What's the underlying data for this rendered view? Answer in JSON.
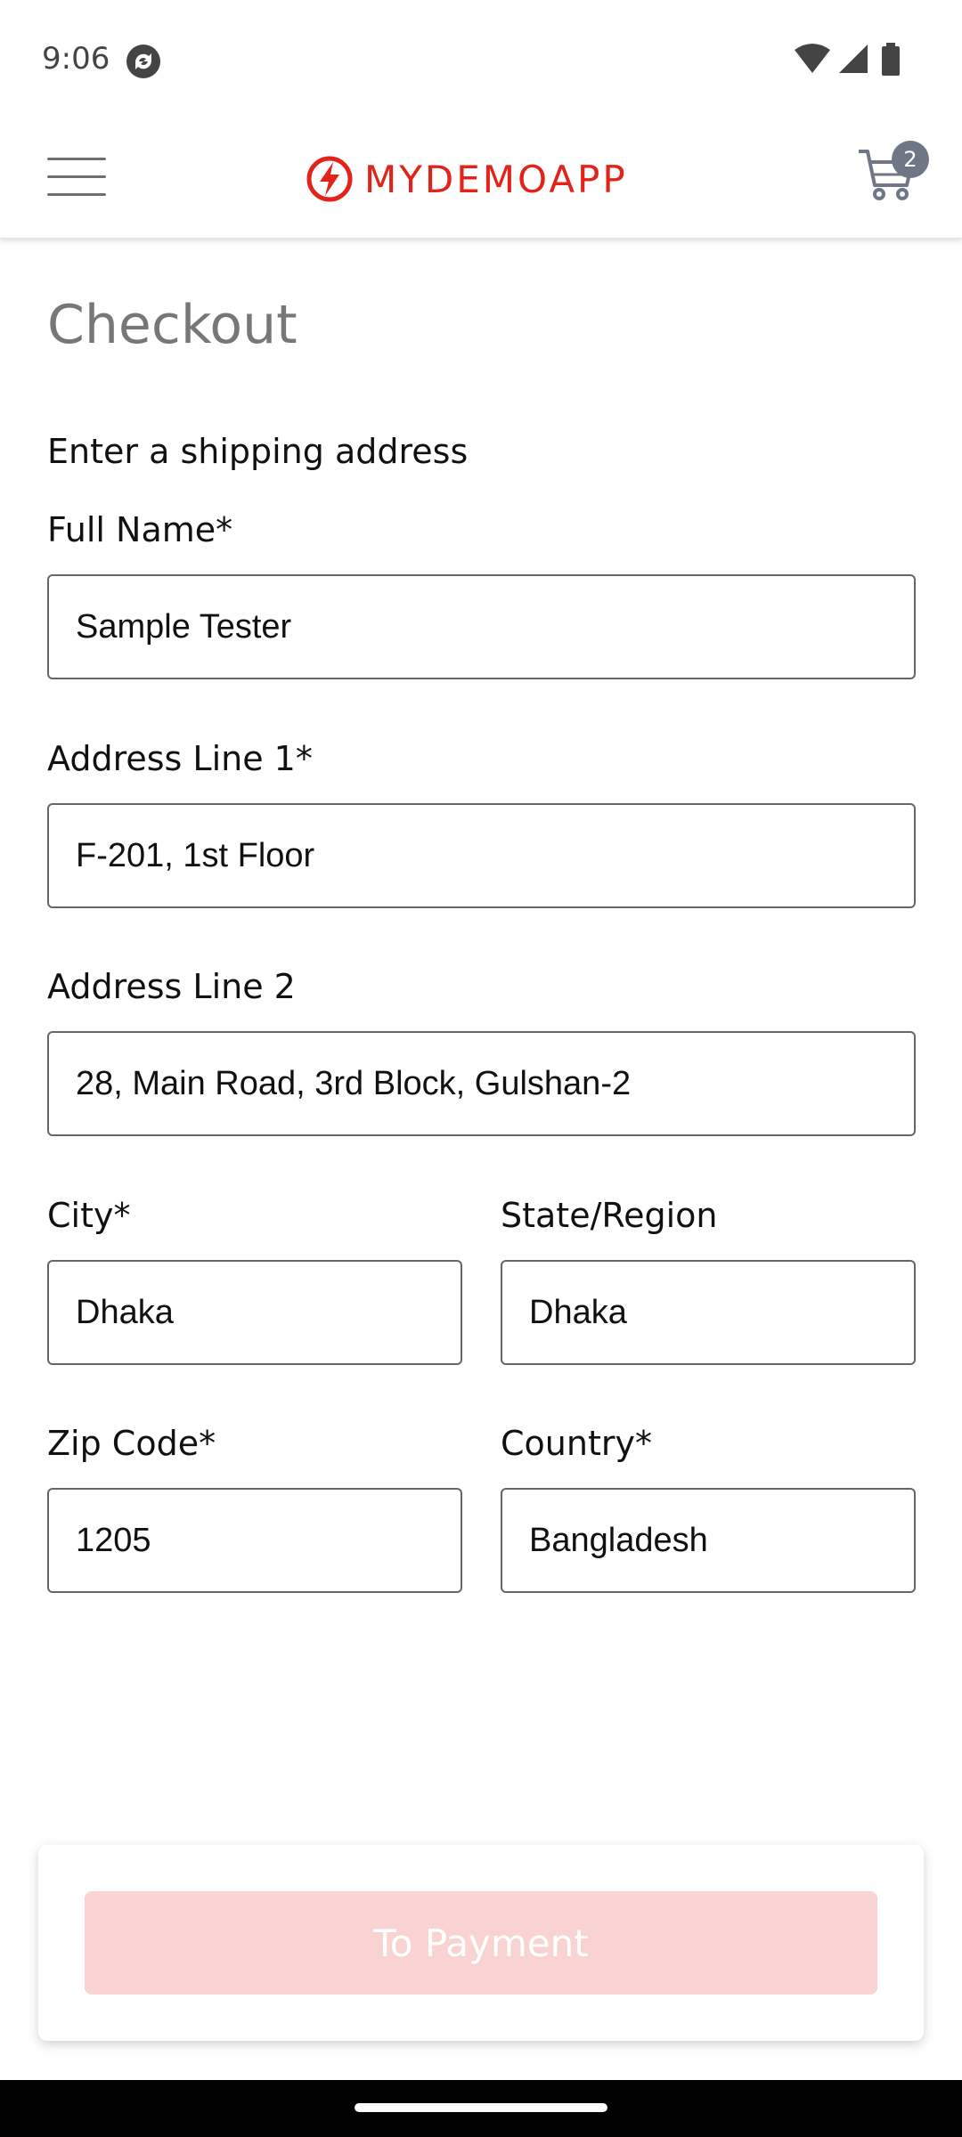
{
  "status_bar": {
    "time": "9:06"
  },
  "header": {
    "logo": "MYDEMOAPP",
    "cart_count": "2",
    "brand_color": "#e2231a"
  },
  "page": {
    "title": "Checkout",
    "section_title": "Enter a shipping address"
  },
  "form": {
    "full_name": {
      "label": "Full Name*",
      "value": "Sample Tester"
    },
    "address1": {
      "label": "Address Line 1*",
      "value": "F-201, 1st Floor"
    },
    "address2": {
      "label": "Address Line 2",
      "value": "28, Main Road, 3rd Block, Gulshan-2"
    },
    "city": {
      "label": "City*",
      "value": "Dhaka"
    },
    "state": {
      "label": "State/Region",
      "value": "Dhaka"
    },
    "zip": {
      "label": "Zip Code*",
      "value": "1205"
    },
    "country": {
      "label": "Country*",
      "value": "Bangladesh"
    }
  },
  "footer": {
    "button_label": "To Payment",
    "button_color": "#f8d3d1"
  }
}
